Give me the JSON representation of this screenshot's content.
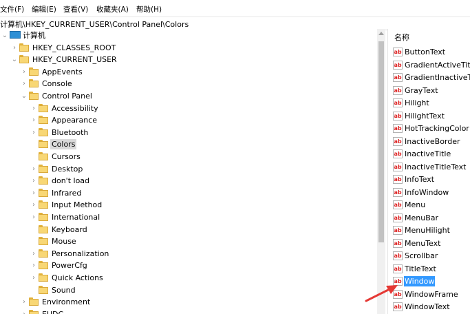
{
  "menu": [
    "文件(F)",
    "编辑(E)",
    "查看(V)",
    "收藏夹(A)",
    "帮助(H)"
  ],
  "address": "计算机\\HKEY_CURRENT_USER\\Control Panel\\Colors",
  "tree": {
    "root": "计算机",
    "hkcr": "HKEY_CLASSES_ROOT",
    "hkcu": "HKEY_CURRENT_USER",
    "hkcu_children": [
      "AppEvents",
      "Console",
      "Control Panel"
    ],
    "control_panel_children": [
      "Accessibility",
      "Appearance",
      "Bluetooth",
      "Colors",
      "Cursors",
      "Desktop",
      "don't load",
      "Infrared",
      "Input Method",
      "International",
      "Keyboard",
      "Mouse",
      "Personalization",
      "PowerCfg",
      "Quick Actions",
      "Sound"
    ],
    "after": [
      "Environment",
      "EUDC"
    ],
    "selected": "Colors"
  },
  "list": {
    "header": "名称",
    "values": [
      "ButtonText",
      "GradientActiveTitle",
      "GradientInactiveTitle",
      "GrayText",
      "Hilight",
      "HilightText",
      "HotTrackingColor",
      "InactiveBorder",
      "InactiveTitle",
      "InactiveTitleText",
      "InfoText",
      "InfoWindow",
      "Menu",
      "MenuBar",
      "MenuHilight",
      "MenuText",
      "Scrollbar",
      "TitleText",
      "Window",
      "WindowFrame",
      "WindowText"
    ],
    "selected": "Window",
    "value_icon": "ab-string-icon",
    "value_icon_text": "ab"
  },
  "colors": {
    "selection": "#3399ff",
    "tree_selection": "#d9d9d9",
    "annotation": "#e53935",
    "folder": "#f8d775"
  }
}
